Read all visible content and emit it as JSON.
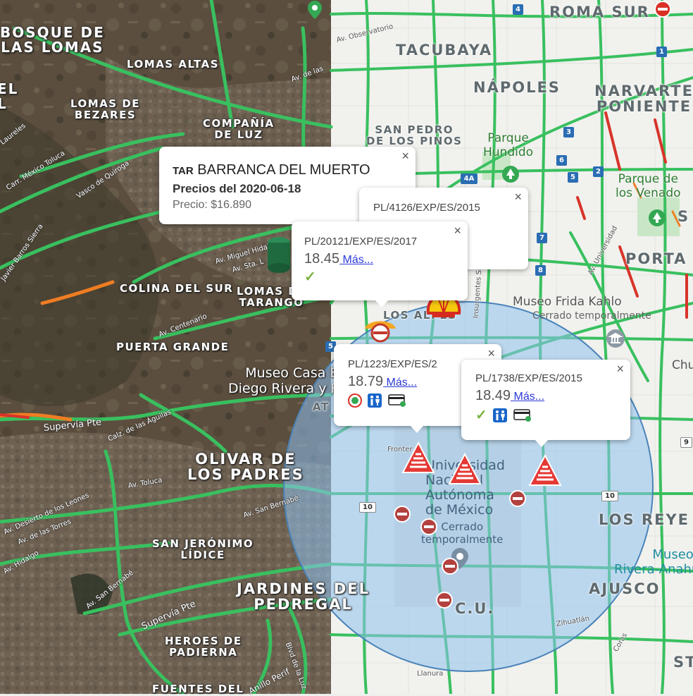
{
  "colors": {
    "traffic_green": "#39c05f",
    "traffic_orange": "#ef7d22",
    "traffic_red": "#d8342a",
    "radius_fill": "#8ec1ef",
    "radius_stroke": "#4a83b8",
    "satellite": "#5a4d3c",
    "road_map": "#f2f2ef",
    "link": "#2b39d6"
  },
  "neighborhoods": {
    "bosque_de_las_lomas": "BOSQUE DE\nLAS LOMAS",
    "lomas_altas": "LOMAS ALTAS",
    "el_fragment": "EL\nL",
    "lomas_de_bezares": "LOMAS DE\nBEZARES",
    "compania_de_luz": "COMPAÑÍA\nDE LUZ",
    "colina_del_sur": "COLINA DEL SUR",
    "lomas_de_tarango": "LOMAS DE\nTARANGO",
    "puerta_grande": "PUERTA GRANDE",
    "olivar_de_los_padres": "OLIVAR DE\nLOS PADRES",
    "san_jeronimo_lidice": "SAN JERÓNIMO\nLÍDICE",
    "jardines_del_pedregal": "JARDINES DEL\nPEDREGAL",
    "heroes_de_padierna": "HEROES DE\nPADIERNA",
    "fuentes_del": "FUENTES DEL",
    "roma_sur": "ROMA SUR",
    "tacubaya": "TACUBAYA",
    "napoles": "NÁPOLES",
    "narvarte_poniente": "NARVARTE\nPONIENTE",
    "san_pedro_de_los_pinos": "SAN PEDRO\nDE LOS PINOS",
    "portales": "PORTA",
    "los_reyes": "LOS REYE",
    "ajusco": "AJUSCO",
    "cu": "C.U.",
    "chu": "Chu",
    "st": "ST",
    "s": "S",
    "los_alpes": "LOS ALPES",
    "at": "AT"
  },
  "pois": {
    "parque_hundido": "Parque\nHundido",
    "parque_venados": "Parque de\nlos Venado",
    "museo_frida": "Museo Frida Kahlo",
    "museo_frida_status": "Cerrado temporalmente",
    "museo_casa_estudio": "Museo Casa E\nDiego Rivera y F",
    "unam": "Universidad\nNacional\nAutónoma\nde México",
    "unam_status": "Cerrado\ntemporalmente",
    "museo_anahuacalli": "Museo D\nRivera-Anahua"
  },
  "roads": {
    "av_observatorio": "Av. Observatorio",
    "laureles": "Laureles",
    "carr_mexico_toluca": "Carr. México Toluca",
    "vasco_de_quiroga": "Vasco de Quiroga",
    "javier_barros_sierra": "Javier Barros Sierra",
    "av_miguel_hidalgo": "Av. Miguel Hidalgo",
    "av_sta_lucia": "Av. Sta. L",
    "av_centenario": "Av. Centenario",
    "av_de_las": "Av. de las",
    "supervia_pte_1": "Supervía Pte",
    "calz_de_las_aguilas": "Calz. de las Águilas",
    "av_toluca": "Av. Toluca",
    "desierto_de_los_leones": "Av. Desierto de los Leones",
    "av_san_bernabe_1": "Av. San Bernabé",
    "av_de_las_torres": "Av. de las Torres",
    "av_hidalgo": "Av. Hidalgo",
    "av_san_bernabe_2": "Av. San Bernabé",
    "supervia_pte_2": "Supervía Pte",
    "blvd_de_la_luz": "Blvd de la Luz",
    "anillo_perif": "Anillo Perif",
    "av_universidad": "Av. Universidad",
    "insurgentes_sur": "Insurgentes Sur",
    "frontera": "Fronter",
    "zihuatlan": "Zihuatlán",
    "llanura": "Llanura",
    "coras": "Coras"
  },
  "shields": [
    "4",
    "1",
    "3",
    "6",
    "5",
    "2",
    "4A",
    "7",
    "8",
    "5",
    "10",
    "10",
    "9"
  ],
  "popups": {
    "main": {
      "brand_prefix": "TAR",
      "station": "BARRANCA DEL MUERTO",
      "prices_date": "Precios del 2020-06-18",
      "price": "Precio: $16.890",
      "close": "×"
    },
    "p1": {
      "permit": "PL/4126/EXP/ES/2015",
      "close": "×"
    },
    "p2": {
      "permit": "PL/20121/EXP/ES/2017",
      "price": "18.45",
      "more": " Más...",
      "close": "×"
    },
    "p3": {
      "permit": "PL/1223/EXP/ES/2",
      "price": "18.79",
      "more": " Más...",
      "close": "×"
    },
    "p4": {
      "permit": "PL/1738/EXP/ES/2015",
      "price": "18.49",
      "more": " Más...",
      "close": "×"
    }
  },
  "icons": {
    "popup_check": "check-icon",
    "restroom": "restroom-icon",
    "card": "card-payment-icon",
    "oxxo": "convenience-store-icon",
    "tree": "park-tree-icon",
    "museum": "museum-icon",
    "no_entry": "road-closed-icon",
    "pemex": "pemex-station-icon",
    "shell": "shell-station-icon",
    "mobil": "mobil-station-icon"
  }
}
